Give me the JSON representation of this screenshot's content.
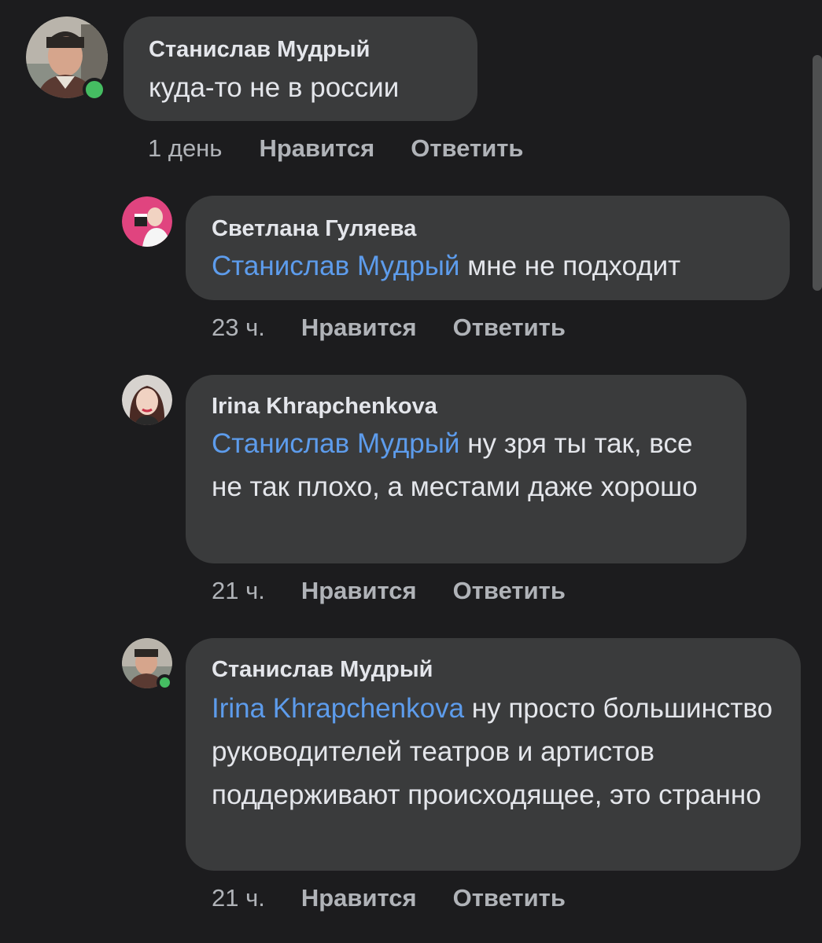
{
  "comments": [
    {
      "author": "Станислав Мудрый",
      "mention": "",
      "text": "куда-то не в россии",
      "time": "1 день",
      "like_label": "Нравится",
      "reply_label": "Ответить"
    },
    {
      "author": "Светлана Гуляева",
      "mention": "Станислав Мудрый",
      "text": "мне не подходит",
      "time": "23 ч.",
      "like_label": "Нравится",
      "reply_label": "Ответить"
    },
    {
      "author": "Irina Khrapchenkova",
      "mention": "Станислав Мудрый",
      "text": "ну зря ты так, все не так плохо, а местами даже хорошо",
      "time": "21 ч.",
      "like_label": "Нравится",
      "reply_label": "Ответить"
    },
    {
      "author": "Станислав Мудрый",
      "mention": "Irina Khrapchenkova",
      "text": "ну просто большинство руководителей театров и артистов поддерживают происходящее, это странно",
      "time": "21 ч.",
      "like_label": "Нравится",
      "reply_label": "Ответить"
    }
  ],
  "colors": {
    "background": "#1c1c1e",
    "bubble": "#3a3b3c",
    "mention": "#5d9cec",
    "online": "#45bd62"
  }
}
